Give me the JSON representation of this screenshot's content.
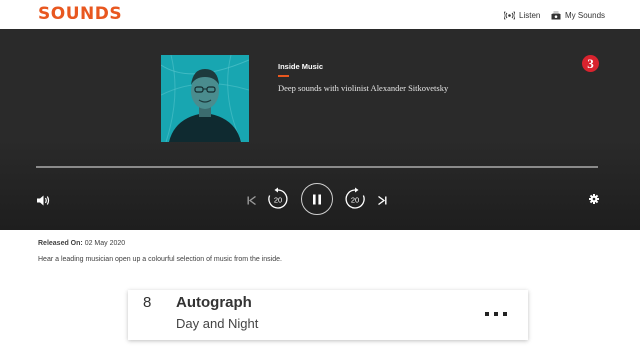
{
  "header": {
    "logo_text": "SOUNDS",
    "listen_label": "Listen",
    "my_sounds_label": "My Sounds"
  },
  "player": {
    "brand": "Inside Music",
    "title": "Deep sounds with violinist Alexander Sitkovetsky",
    "station_badge": "3",
    "progress_fraction": 0.0,
    "skip_back_seconds": "20",
    "skip_forward_seconds": "20",
    "icons": {
      "volume": "volume-icon",
      "previous": "skip-previous-icon",
      "rewind": "rewind-20-icon",
      "pause": "pause-icon",
      "forward": "forward-20-icon",
      "next": "skip-next-icon",
      "settings": "gear-icon"
    }
  },
  "details": {
    "released_label": "Released On:",
    "released_date": "02 May 2020",
    "summary": "Hear a leading musician open up a colourful selection of music from the inside."
  },
  "track": {
    "number": "8",
    "artist": "Autograph",
    "name": "Day and Night",
    "more_icon": "more-options-icon"
  },
  "colors": {
    "brand_orange": "#e8571f",
    "radio3_red": "#d9232e",
    "player_bg": "#2a2a2a",
    "artwork_teal": "#16a9b5"
  }
}
